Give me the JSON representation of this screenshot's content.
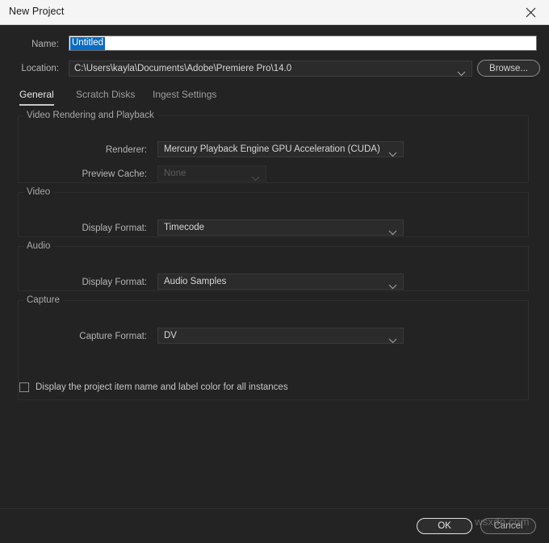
{
  "window": {
    "title": "New Project",
    "close_icon": "close-icon"
  },
  "form": {
    "name_label": "Name:",
    "name_value": "Untitled",
    "location_label": "Location:",
    "location_value": "C:\\Users\\kayla\\Documents\\Adobe\\Premiere Pro\\14.0",
    "browse_label": "Browse..."
  },
  "tabs": [
    {
      "label": "General",
      "active": true
    },
    {
      "label": "Scratch Disks",
      "active": false
    },
    {
      "label": "Ingest Settings",
      "active": false
    }
  ],
  "groups": {
    "video_rendering": {
      "title": "Video Rendering and Playback",
      "renderer_label": "Renderer:",
      "renderer_value": "Mercury Playback Engine GPU Acceleration (CUDA)",
      "preview_cache_label": "Preview Cache:",
      "preview_cache_value": "None"
    },
    "video": {
      "title": "Video",
      "display_format_label": "Display Format:",
      "display_format_value": "Timecode"
    },
    "audio": {
      "title": "Audio",
      "display_format_label": "Display Format:",
      "display_format_value": "Audio Samples"
    },
    "capture": {
      "title": "Capture",
      "capture_format_label": "Capture Format:",
      "capture_format_value": "DV"
    }
  },
  "options": {
    "display_project_item_label": "Display the project item name and label color for all instances",
    "display_project_item_checked": false
  },
  "footer": {
    "ok_label": "OK",
    "cancel_label": "Cancel"
  },
  "watermark": "wsxdn.com",
  "colors": {
    "dialog_bg": "#232323",
    "titlebar_bg": "#f5f5f5",
    "selection_blue": "#0a6cc4",
    "field_bg": "#2b2b2b",
    "text_primary": "#d6d6d6",
    "text_label": "#b4b4b4"
  }
}
